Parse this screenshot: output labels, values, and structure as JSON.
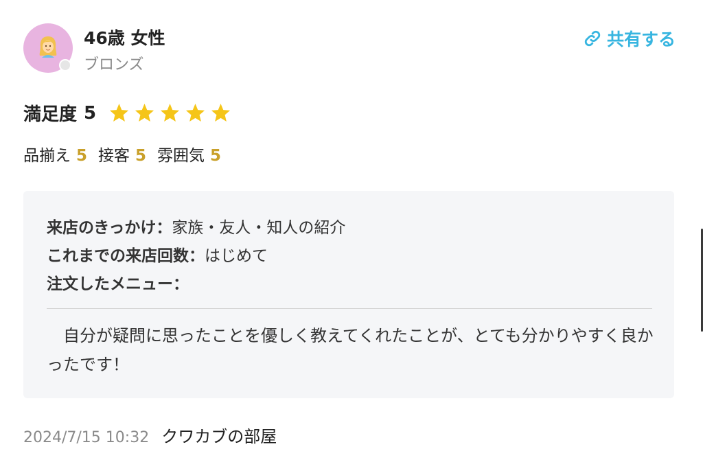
{
  "reviewer": {
    "name": "46歳 女性",
    "rank": "ブロンズ",
    "avatar_icon": "blonde-person-icon"
  },
  "share": {
    "label": "共有する",
    "icon": "link-icon",
    "color": "#37b5e0"
  },
  "rating": {
    "label": "満足度",
    "value": "5",
    "stars": 5,
    "star_color": "#f5c518",
    "sub_ratings": [
      {
        "label": "品揃え",
        "value": "5"
      },
      {
        "label": "接客",
        "value": "5"
      },
      {
        "label": "雰囲気",
        "value": "5"
      }
    ],
    "sub_value_color": "#c9a02a"
  },
  "details": {
    "rows": [
      {
        "key": "来店のきっかけ：",
        "value": "家族・友人・知人の紹介"
      },
      {
        "key": "これまでの来店回数：",
        "value": "はじめて"
      },
      {
        "key": "注文したメニュー：",
        "value": ""
      }
    ],
    "comment": "　自分が疑問に思ったことを優しく教えてくれたことが、とても分かりやすく良かったです！"
  },
  "footer": {
    "date": "2024/7/15 10:32",
    "shop": "クワカブの部屋"
  }
}
